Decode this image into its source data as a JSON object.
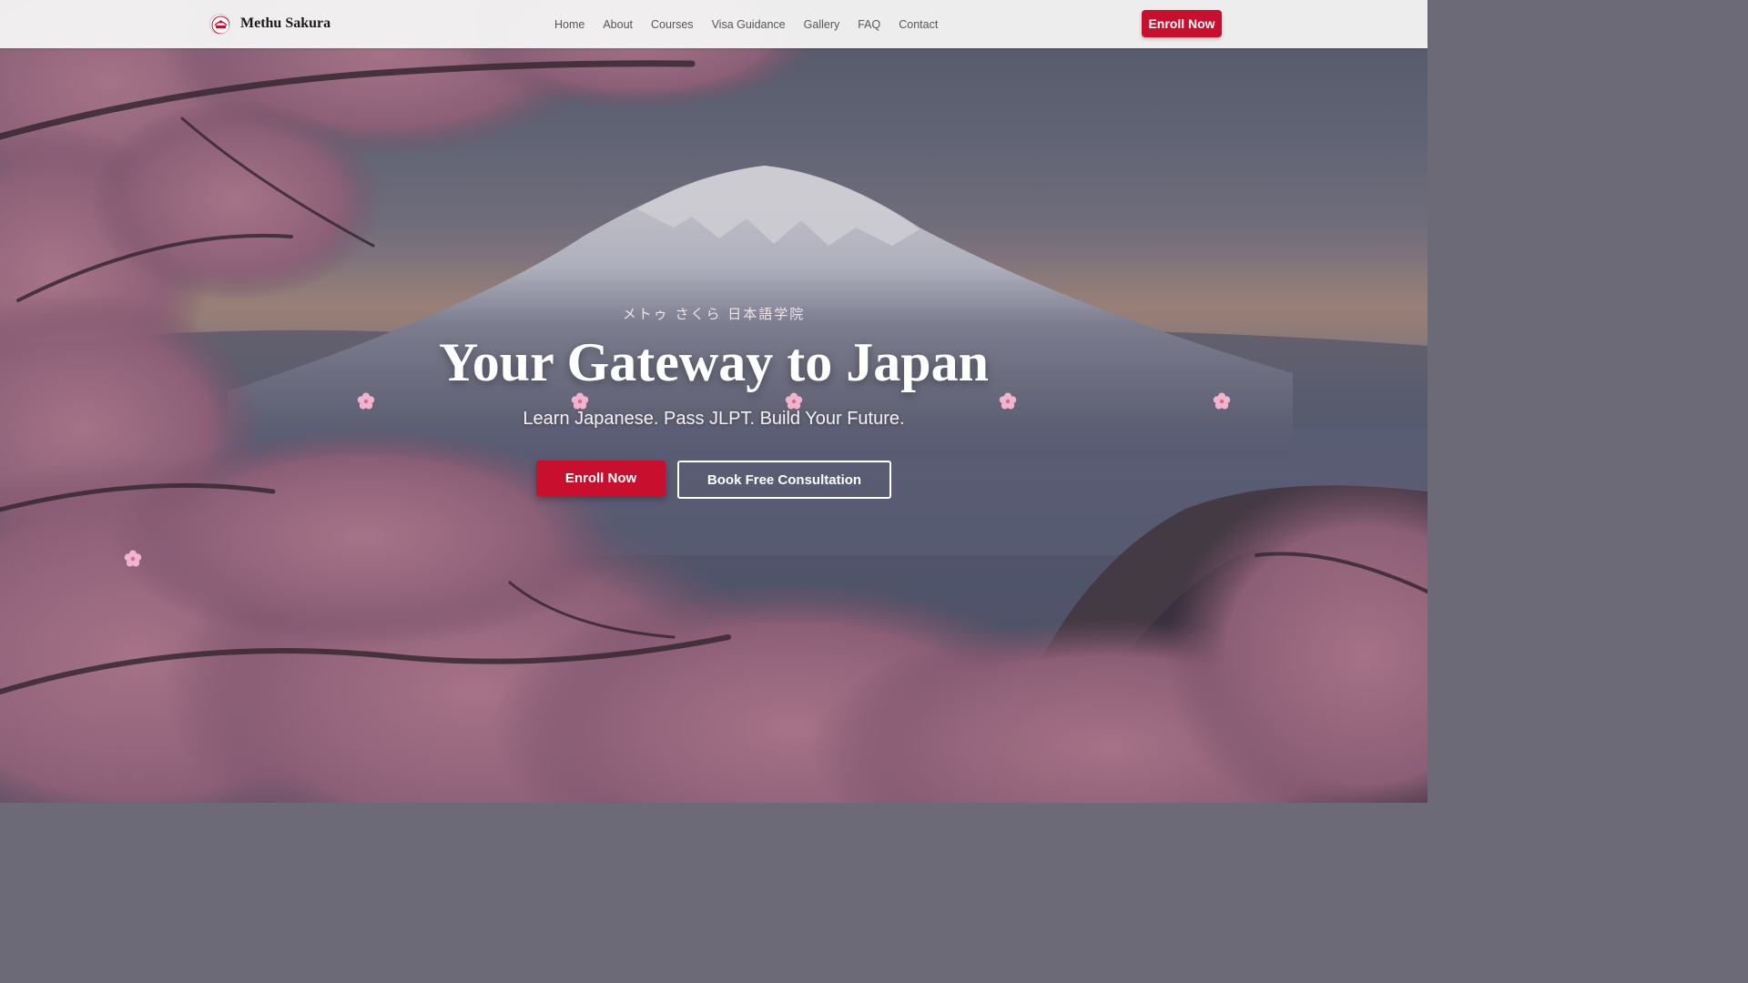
{
  "navbar": {
    "brand_name": "Methu Sakura",
    "links": [
      "Home",
      "About",
      "Courses",
      "Visa Guidance",
      "Gallery",
      "FAQ",
      "Contact"
    ],
    "cta_label": "Enroll Now"
  },
  "hero": {
    "kanji_tagline": "メトゥ さくら 日本語学院",
    "headline": "Your Gateway to Japan",
    "subheadline": "Learn Japanese. Pass JLPT. Build Your Future.",
    "primary_button": "Enroll Now",
    "secondary_button": "Book Free Consultation"
  },
  "icons": {
    "logo": "sakura-badge-icon",
    "petal": "cherry-blossom-icon"
  },
  "colors": {
    "accent": "#c8102e",
    "navbar_bg": "#f4f4f4",
    "blossom": "#e9a8c4",
    "text_light": "#ffffff"
  }
}
